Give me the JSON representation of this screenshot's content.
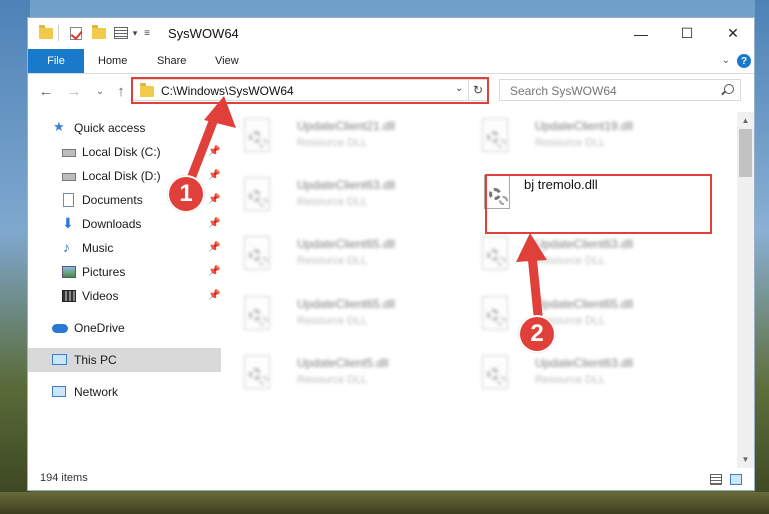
{
  "window": {
    "title": "SysWOW64",
    "caption": {
      "minimize": "—",
      "maximize": "☐",
      "close": "✕"
    }
  },
  "ribbon": {
    "tabs": [
      "File",
      "Home",
      "Share",
      "View"
    ],
    "help": "?",
    "expand": "⌄"
  },
  "nav": {
    "back": "←",
    "forward": "→",
    "recent": "⌄",
    "up": "↑",
    "address": "C:\\Windows\\SysWOW64",
    "address_dropdown": "⌄",
    "refresh": "↻",
    "search_placeholder": "Search SysWOW64"
  },
  "sidebar": {
    "items": [
      {
        "label": "Quick access",
        "icon": "star-icon"
      },
      {
        "label": "Local Disk (C:)",
        "icon": "disk-icon",
        "pinned": true
      },
      {
        "label": "Local Disk (D:)",
        "icon": "disk-icon",
        "pinned": true
      },
      {
        "label": "Documents",
        "icon": "document-icon",
        "pinned": true
      },
      {
        "label": "Downloads",
        "icon": "download-icon",
        "pinned": true
      },
      {
        "label": "Music",
        "icon": "music-icon",
        "pinned": true
      },
      {
        "label": "Pictures",
        "icon": "picture-icon",
        "pinned": true
      },
      {
        "label": "Videos",
        "icon": "video-icon",
        "pinned": true
      },
      {
        "label": "OneDrive",
        "icon": "cloud-icon"
      },
      {
        "label": "This PC",
        "icon": "computer-icon",
        "selected": true
      },
      {
        "label": "Network",
        "icon": "network-icon"
      }
    ]
  },
  "files": [
    {
      "name": "UpdateClient21.dll",
      "desc": "Resource DLL"
    },
    {
      "name": "UpdateClient19.dll",
      "desc": "Resource DLL"
    },
    {
      "name": "UpdateClient63.dll",
      "desc": "Resource DLL"
    },
    {
      "name": "bj tremolo.dll",
      "desc": ""
    },
    {
      "name": "UpdateClient65.dll",
      "desc": "Resource DLL"
    },
    {
      "name": "UpdateClient63.dll",
      "desc": "Resource DLL"
    },
    {
      "name": "UpdateClient65.dll",
      "desc": "Resource DLL"
    },
    {
      "name": "UpdateClient65.dll",
      "desc": "Resource DLL"
    },
    {
      "name": "UpdateClient5.dll",
      "desc": "Resource DLL"
    },
    {
      "name": "UpdateClient63.dll",
      "desc": "Resource DLL"
    }
  ],
  "status": {
    "count": "194 items"
  },
  "annotations": {
    "marker1": "1",
    "marker2": "2",
    "color": "#e0403a"
  }
}
